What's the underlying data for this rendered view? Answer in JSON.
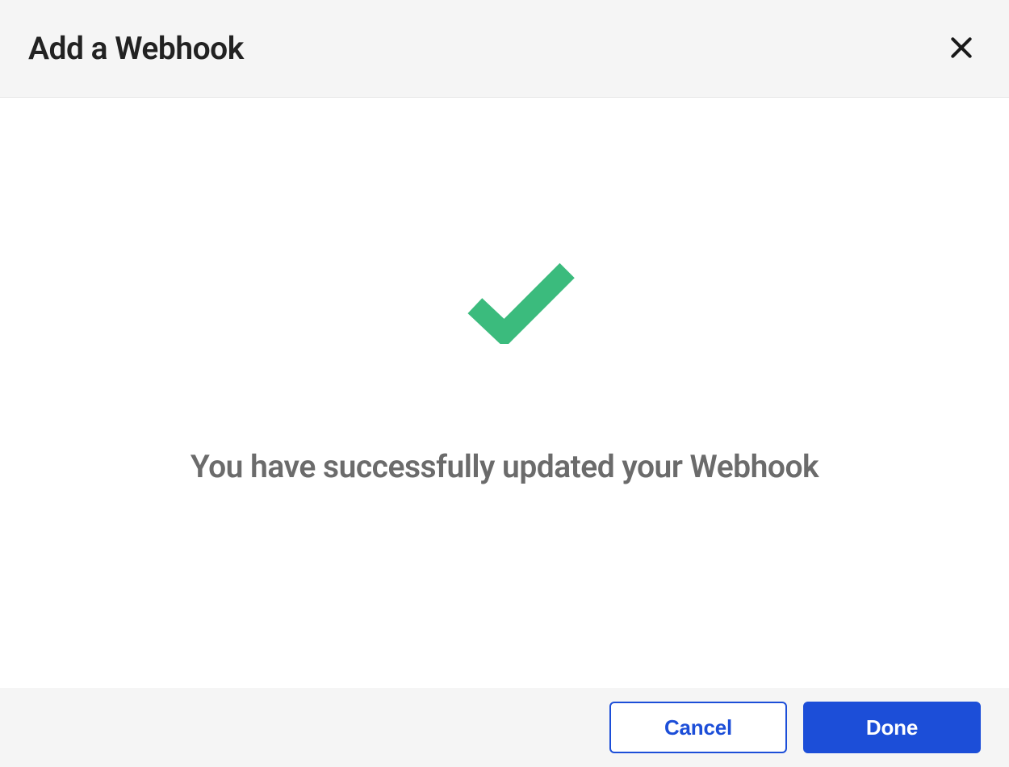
{
  "header": {
    "title": "Add a Webhook"
  },
  "content": {
    "success_message": "You have successfully updated your Webhook"
  },
  "footer": {
    "cancel_label": "Cancel",
    "done_label": "Done"
  }
}
